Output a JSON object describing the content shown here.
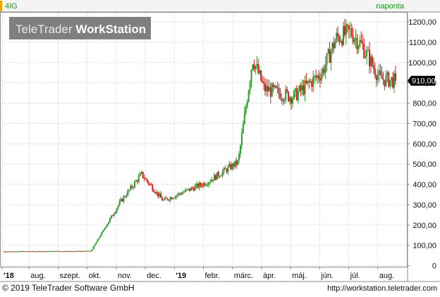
{
  "header": {
    "symbol": "4IG",
    "interval": "naponta"
  },
  "logo": {
    "brand": "TeleTrader",
    "product": "WorkStation"
  },
  "footer": {
    "copyright": "© 2019 TeleTrader Software GmbH",
    "url": "http://workstation.teletrader.com"
  },
  "colors": {
    "up": "#2e9a2e",
    "down": "#d42020",
    "grid": "#b8b8b8",
    "frame": "#8c8c8c",
    "logo_bg": "#7f7f7f",
    "interval_text": "#1a9a1a",
    "marker_left": "#f0a000",
    "price_tag_bg": "#000000",
    "price_tag_text": "#ffffff"
  },
  "chart_data": {
    "type": "candlestick",
    "x_tick_labels": [
      "'18",
      "aug.",
      "szept.",
      "okt.",
      "nov.",
      "dec.",
      "'19",
      "febr.",
      "márc.",
      "ápr.",
      "máj.",
      "jún.",
      "júl.",
      "aug."
    ],
    "y_tick_labels": [
      "0",
      "100,00",
      "200,00",
      "300,00",
      "400,00",
      "500,00",
      "600,00",
      "700,00",
      "800,00",
      "900,00",
      "1000,00",
      "1100,00",
      "1200,00"
    ],
    "ylim": [
      -5,
      1245
    ],
    "grid": true,
    "last_price_label": "910,00",
    "last_price": 910,
    "key_points": [
      {
        "month_index": 0,
        "close": 70
      },
      {
        "month_index": 3,
        "close": 72
      },
      {
        "month_index": 4,
        "close": 310
      },
      {
        "month_index": 4.75,
        "close": 450
      },
      {
        "month_index": 5.5,
        "close": 320
      },
      {
        "month_index": 7,
        "close": 410
      },
      {
        "month_index": 8.1,
        "close": 510
      },
      {
        "month_index": 8.6,
        "close": 1020
      },
      {
        "month_index": 9,
        "close": 870
      },
      {
        "month_index": 10,
        "close": 830
      },
      {
        "month_index": 11,
        "close": 950
      },
      {
        "month_index": 11.5,
        "close": 1120
      },
      {
        "month_index": 12,
        "close": 1150
      },
      {
        "month_index": 12.4,
        "close": 1080
      },
      {
        "month_index": 13,
        "close": 920
      },
      {
        "month_index": 13.55,
        "close": 910
      }
    ]
  }
}
